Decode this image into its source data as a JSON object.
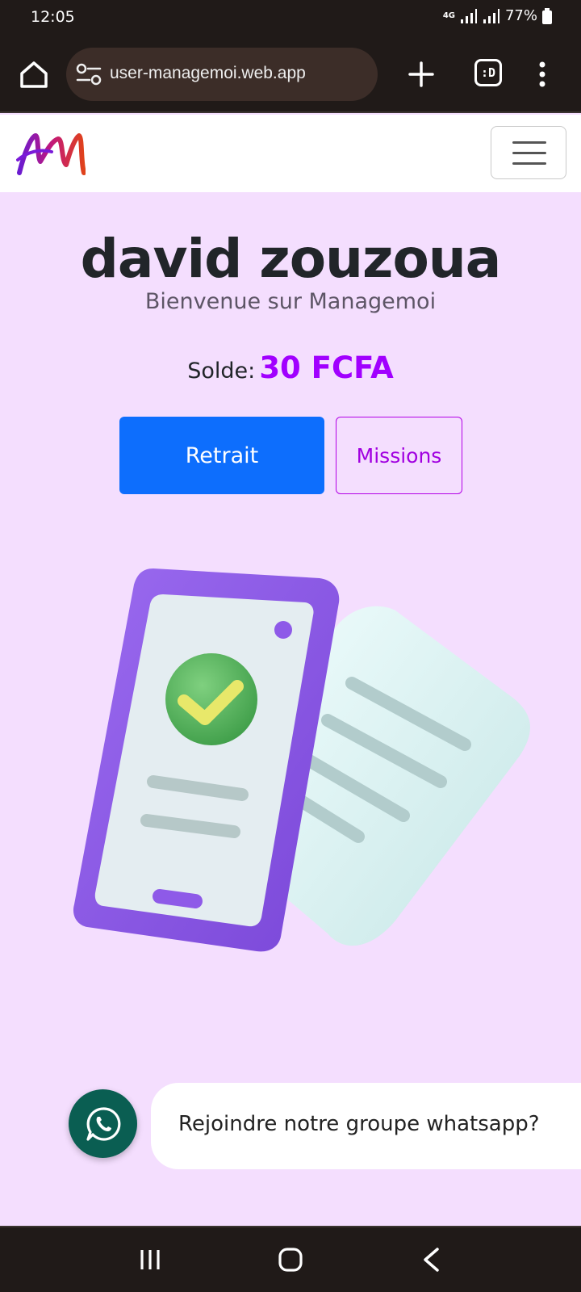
{
  "status_bar": {
    "time": "12:05",
    "network": "4G",
    "battery": "77%"
  },
  "browser": {
    "url": "user-managemoi.web.app",
    "tabs_label": ":D"
  },
  "site": {
    "logo_icon": "managemoi-m-logo",
    "menu_icon": "hamburger-icon"
  },
  "profile": {
    "name": "david zouzoua",
    "welcome": "Bienvenue sur Managemoi",
    "balance_label": "Solde:",
    "balance_value": "30 FCFA"
  },
  "actions": {
    "retrait_label": "Retrait",
    "missions_label": "Missions"
  },
  "illustration": {
    "icon": "phone-check-document-illustration"
  },
  "whatsapp": {
    "prompt": "Rejoindre notre groupe whatsapp?",
    "icon": "whatsapp-icon"
  },
  "colors": {
    "page_bg": "#f4defe",
    "primary": "#0d6efd",
    "accent": "#a100ff",
    "whatsapp": "#0a5e52"
  }
}
